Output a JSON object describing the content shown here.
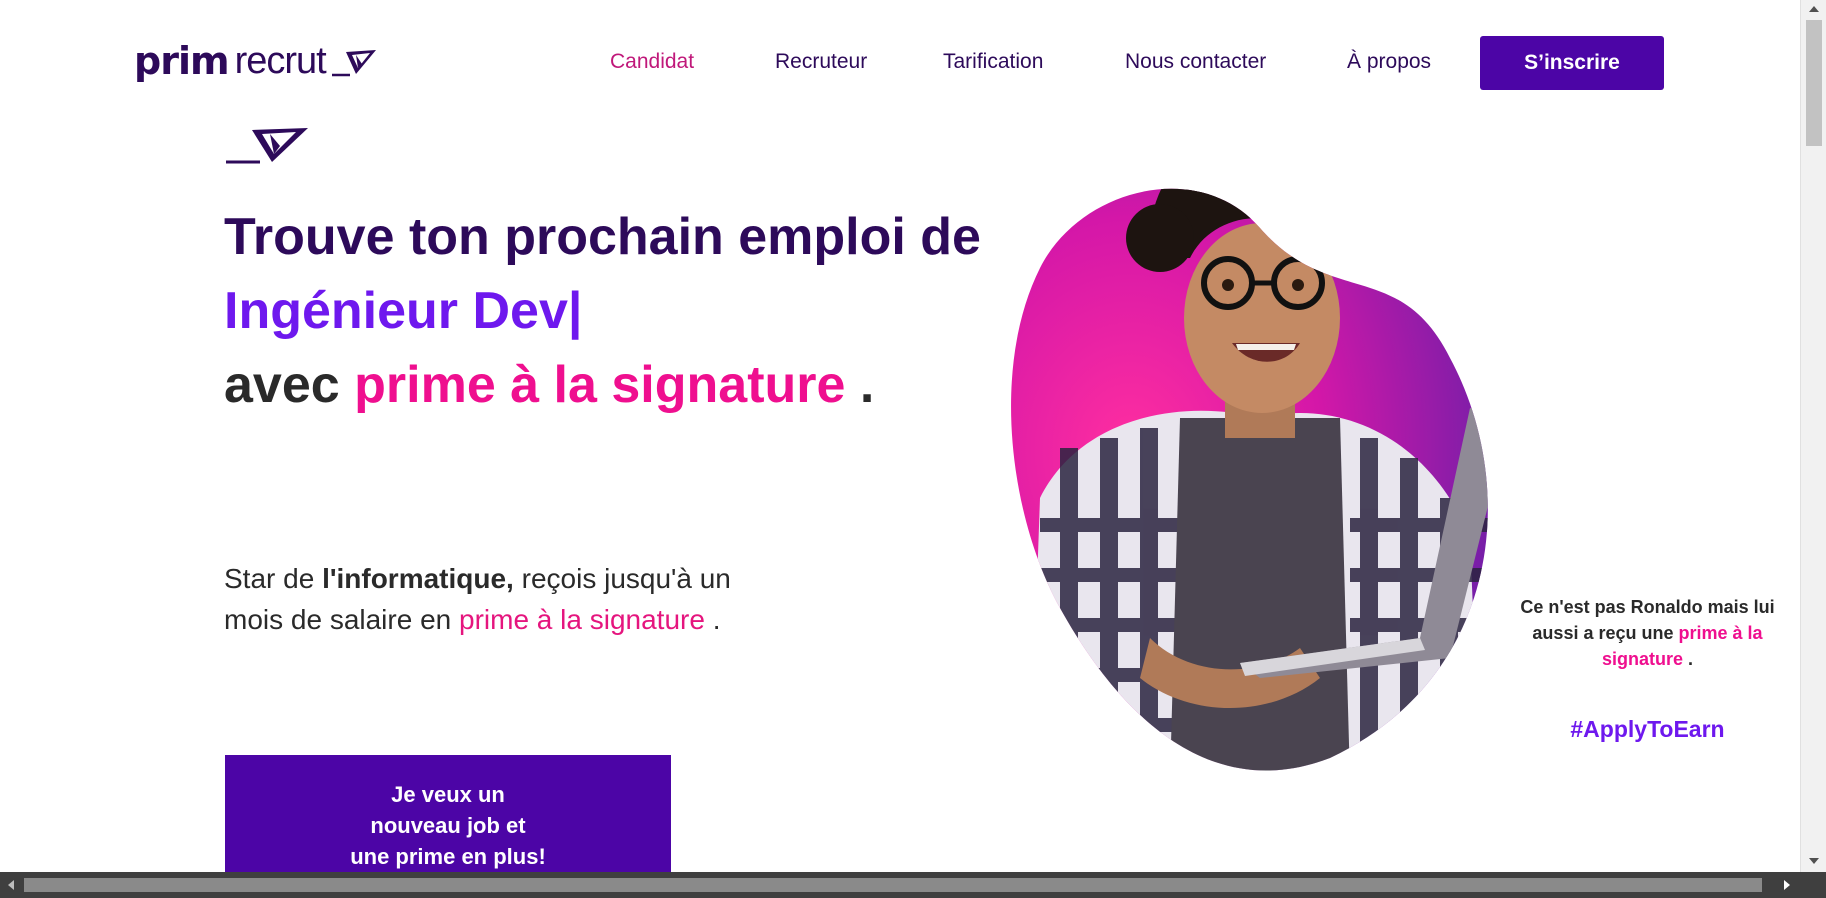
{
  "brand": {
    "name_bold": "prim",
    "name_light": "recrut"
  },
  "nav": {
    "items": [
      {
        "label": "Candidat",
        "active": true
      },
      {
        "label": "Recruteur",
        "active": false
      },
      {
        "label": "Tarification",
        "active": false
      },
      {
        "label": "Nous contacter",
        "active": false
      },
      {
        "label": "À propos",
        "active": false
      }
    ],
    "signup_label": "S’inscrire"
  },
  "hero": {
    "line1": "Trouve ton prochain emploi de",
    "role": "Ingénieur Dev|",
    "line3_prefix": "avec",
    "line3_highlight": "prime à la signature",
    "line3_suffix": ".",
    "sub_prefix": "Star de",
    "sub_bold": "l'informatique,",
    "sub_middle": "reçois jusqu'à un mois de salaire en",
    "sub_highlight": "prime à la signature",
    "sub_suffix": ".",
    "cta_lines": [
      "Je veux un",
      "nouveau job et",
      "une prime en plus!"
    ]
  },
  "caption": {
    "prefix": "Ce n'est pas Ronaldo mais lui aussi a reçu une",
    "highlight": "prime à la signature",
    "suffix": ".",
    "hashtag": "#ApplyToEarn"
  },
  "colors": {
    "brand_dark": "#2d0a5a",
    "brand_purple": "#4c05a6",
    "accent_violet": "#6e18ee",
    "accent_pink": "#ef0f8f"
  },
  "icons": [
    "paper-plane-logo-icon",
    "scroll-arrow-up-icon",
    "scroll-arrow-down-icon",
    "scroll-arrow-left-icon",
    "scroll-arrow-right-icon"
  ]
}
